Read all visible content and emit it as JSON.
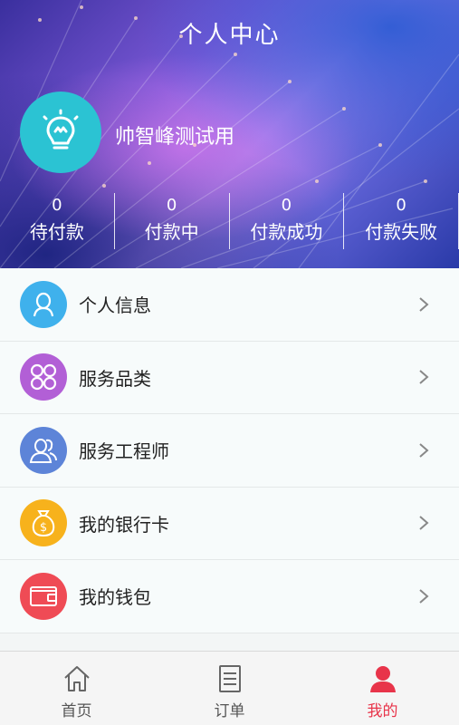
{
  "header": {
    "title": "个人中心",
    "username": "帅智峰测试用",
    "avatar_icon": "lightbulb-icon"
  },
  "stats": [
    {
      "value": "0",
      "label": "待付款"
    },
    {
      "value": "0",
      "label": "付款中"
    },
    {
      "value": "0",
      "label": "付款成功"
    },
    {
      "value": "0",
      "label": "付款失败"
    }
  ],
  "menu": [
    {
      "label": "个人信息",
      "icon": "person-icon",
      "color": "#3fb1ec"
    },
    {
      "label": "服务品类",
      "icon": "clover-icon",
      "color": "#b25fd6"
    },
    {
      "label": "服务工程师",
      "icon": "users-icon",
      "color": "#5d84d8"
    },
    {
      "label": "我的银行卡",
      "icon": "money-bag-icon",
      "color": "#f7b21c"
    },
    {
      "label": "我的钱包",
      "icon": "wallet-icon",
      "color": "#ef4b55"
    }
  ],
  "tabbar": {
    "tabs": [
      {
        "label": "首页",
        "icon": "home-icon"
      },
      {
        "label": "订单",
        "icon": "document-icon"
      },
      {
        "label": "我的",
        "icon": "profile-icon"
      }
    ],
    "active_color": "#e8344a"
  }
}
